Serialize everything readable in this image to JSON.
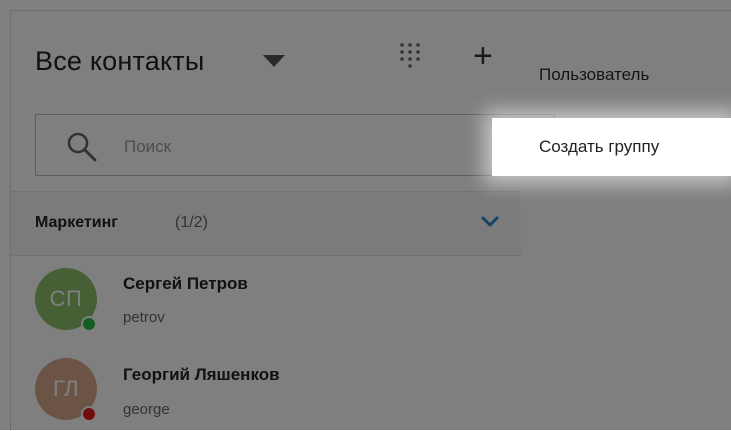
{
  "header": {
    "title": "Все контакты",
    "icons": [
      "caret-down-icon",
      "dialpad-icon",
      "plus-icon"
    ]
  },
  "search": {
    "placeholder": "Поиск",
    "value": ""
  },
  "groups": [
    {
      "name": "Маркетинг",
      "count": "(1/2)",
      "contacts": [
        {
          "initials": "СП",
          "name": "Сергей Петров",
          "login": "petrov",
          "avatar_color": "#8fbf68",
          "status": "online",
          "status_color": "#2fb84a"
        },
        {
          "initials": "ГЛ",
          "name": "Георгий Ляшенков",
          "login": "george",
          "avatar_color": "#d7a98a",
          "status": "busy",
          "status_color": "#e01b1b"
        }
      ]
    }
  ],
  "menu": {
    "items": [
      {
        "label": "Пользователь",
        "highlighted": false
      },
      {
        "label": "Создать группу",
        "highlighted": true
      }
    ]
  },
  "colors": {
    "accent": "#2a88c8",
    "overlay": "rgba(0,0,0,0.5)"
  }
}
